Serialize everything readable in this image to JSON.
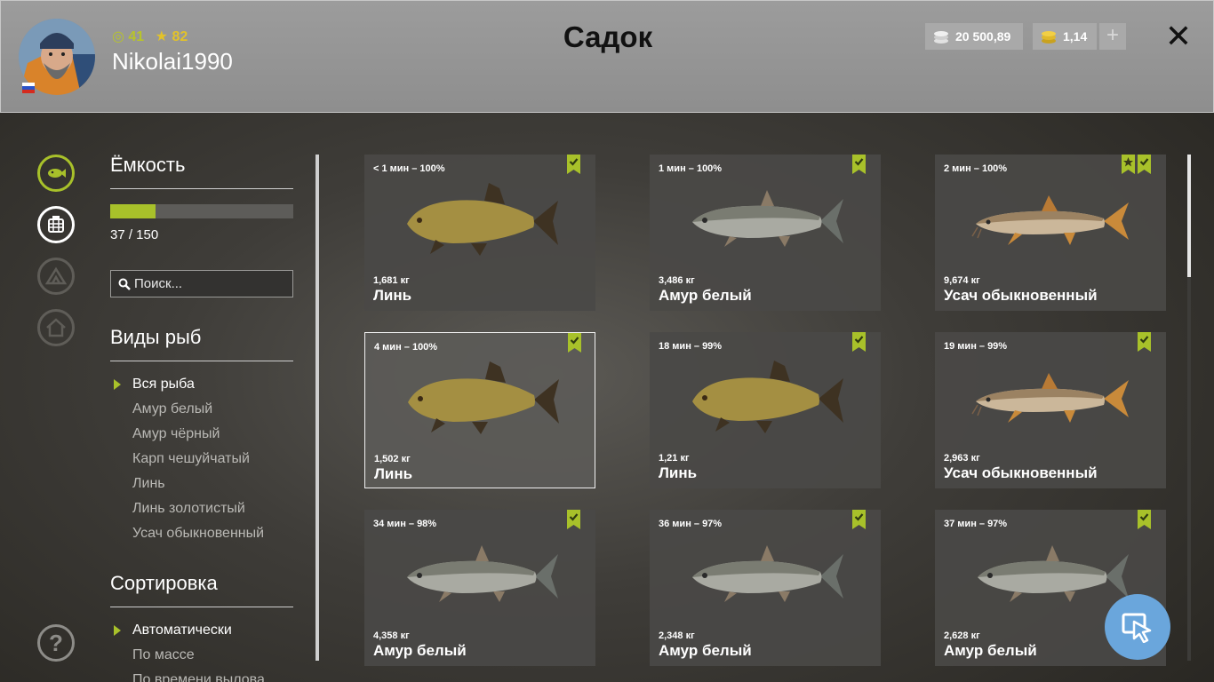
{
  "header": {
    "title": "Садок",
    "username": "Nikolai1990",
    "level": "41",
    "rank": "82",
    "silver": "20 500,89",
    "gold": "1,14",
    "plus": "+",
    "close": "✕"
  },
  "sidebar": {
    "capacity_title": "Ёмкость",
    "capacity_text": "37 / 150",
    "capacity_fraction": 0.2467,
    "search_placeholder": "Поиск...",
    "species_title": "Виды рыб",
    "species": [
      "Вся рыба",
      "Амур белый",
      "Амур чёрный",
      "Карп чешуйчатый",
      "Линь",
      "Линь золотистый",
      "Усач обыкновенный"
    ],
    "sort_title": "Сортировка",
    "sort": [
      "Автоматически",
      "По массе",
      "По времени вылова"
    ],
    "help": "?"
  },
  "cards": [
    {
      "time": "< 1 мин – 100%",
      "weight": "1,681 кг",
      "name": "Линь",
      "fish": "tench",
      "star": false
    },
    {
      "time": "1 мин – 100%",
      "weight": "3,486 кг",
      "name": "Амур белый",
      "fish": "carp",
      "star": false
    },
    {
      "time": "2 мин – 100%",
      "weight": "9,674 кг",
      "name": "Усач обыкновенный",
      "fish": "barbel",
      "star": true
    },
    {
      "time": "4 мин – 100%",
      "weight": "1,502 кг",
      "name": "Линь",
      "fish": "tench",
      "star": false
    },
    {
      "time": "18 мин – 99%",
      "weight": "1,21 кг",
      "name": "Линь",
      "fish": "tench",
      "star": false
    },
    {
      "time": "19 мин – 99%",
      "weight": "2,963 кг",
      "name": "Усач обыкновенный",
      "fish": "barbel",
      "star": false
    },
    {
      "time": "34 мин – 98%",
      "weight": "4,358 кг",
      "name": "Амур белый",
      "fish": "carp",
      "star": false
    },
    {
      "time": "36 мин – 97%",
      "weight": "2,348 кг",
      "name": "Амур белый",
      "fish": "carp",
      "star": false
    },
    {
      "time": "37 мин – 97%",
      "weight": "2,628 кг",
      "name": "Амур белый",
      "fish": "carp",
      "star": false
    }
  ],
  "colors": {
    "accent": "#a8c12a",
    "star": "#e2c22a",
    "fab": "#6aa6dc"
  }
}
